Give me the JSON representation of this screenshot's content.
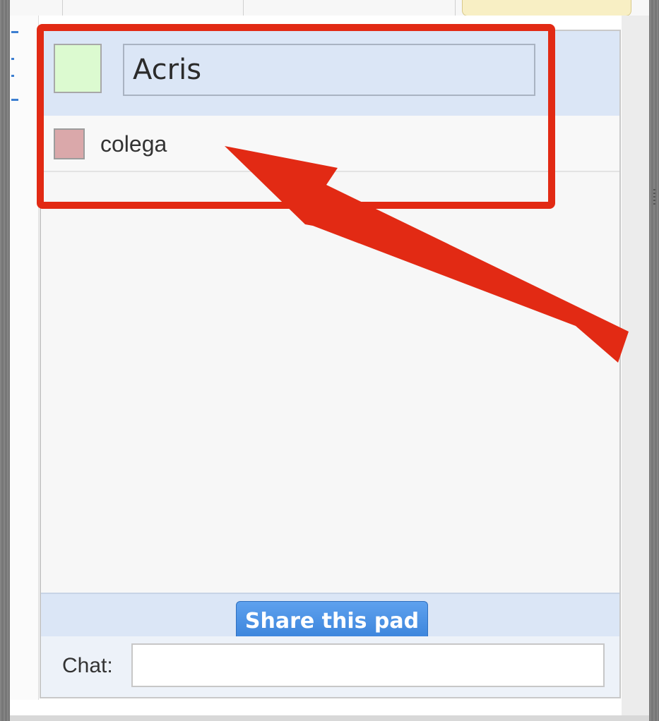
{
  "users": {
    "me": {
      "name": "Acris",
      "color": "#dcfad0"
    },
    "others": [
      {
        "name": "colega",
        "color": "#daa8aa"
      }
    ]
  },
  "share": {
    "label": "Share this pad"
  },
  "chat": {
    "label": "Chat:",
    "value": "",
    "placeholder": ""
  },
  "annotation": {
    "color": "#e22a14"
  }
}
